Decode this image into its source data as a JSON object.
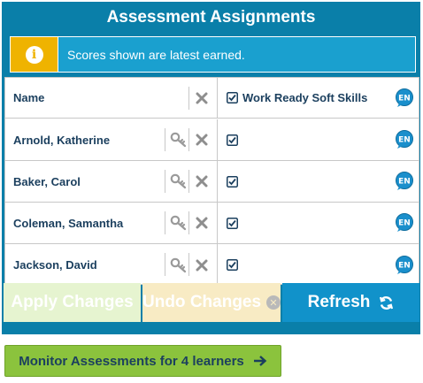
{
  "panel": {
    "title": "Assessment Assignments",
    "info_text": "Scores shown are latest earned.",
    "info_icon": "info-icon",
    "colors": {
      "panel_bg": "#0a7fa9",
      "info_bg": "#1aa0cf",
      "info_icon_bg": "#efb300"
    }
  },
  "grid": {
    "name_header": "Name",
    "assessment_header": "Work Ready Soft Skills",
    "language_badge": "EN",
    "learners": [
      {
        "name": "Arnold, Katherine",
        "assigned": true
      },
      {
        "name": "Baker, Carol",
        "assigned": true
      },
      {
        "name": "Coleman, Samantha",
        "assigned": true
      },
      {
        "name": "Jackson, David",
        "assigned": true
      }
    ]
  },
  "buttons": {
    "apply": "Apply Changes",
    "undo": "Undo Changes",
    "refresh": "Refresh",
    "monitor": "Monitor Assessments for 4 learners"
  }
}
